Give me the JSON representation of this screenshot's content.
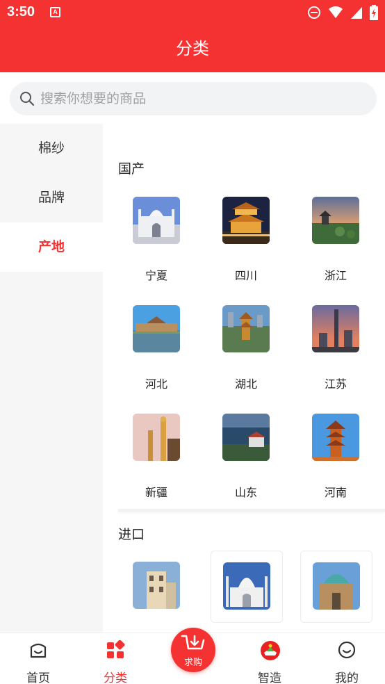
{
  "status_bar": {
    "time": "3:50",
    "badge": "A"
  },
  "header": {
    "title": "分类"
  },
  "search": {
    "placeholder": "搜索你想要的商品"
  },
  "sidebar": {
    "items": [
      {
        "label": "棉纱",
        "active": false
      },
      {
        "label": "品牌",
        "active": false
      },
      {
        "label": "产地",
        "active": true
      }
    ]
  },
  "content": {
    "domestic_title": "国产",
    "domestic": [
      {
        "label": "宁夏"
      },
      {
        "label": "四川"
      },
      {
        "label": "浙江"
      },
      {
        "label": "河北"
      },
      {
        "label": "湖北"
      },
      {
        "label": "江苏"
      },
      {
        "label": "新疆"
      },
      {
        "label": "山东"
      },
      {
        "label": "河南"
      }
    ],
    "import_title": "进口"
  },
  "tabbar": {
    "home": "首页",
    "category": "分类",
    "request": "求购",
    "smart": "智造",
    "mine": "我的"
  },
  "colors": {
    "brand": "#f53232"
  }
}
